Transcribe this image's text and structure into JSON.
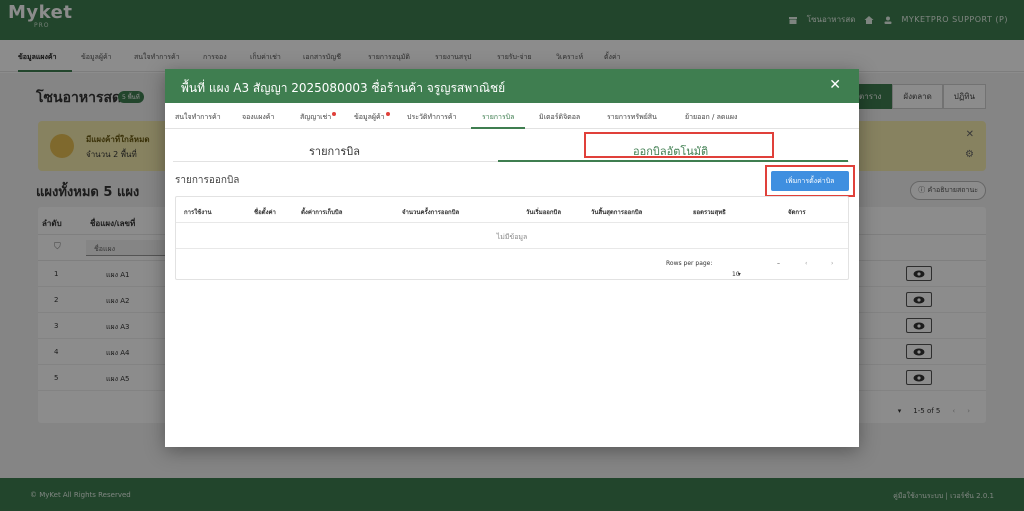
{
  "app": {
    "logo_main": "Myket",
    "logo_sub": "PRO",
    "top_zone": "โซนอาหารสด",
    "user": "MYKETPRO SUPPORT (P)"
  },
  "nav": {
    "tabs": [
      "ข้อมูลแผงค้า",
      "ข้อมูลผู้ค้า",
      "สนใจทำการค้า",
      "การจอง",
      "เก็บค่าเช่า",
      "เอกสารบัญชี",
      "รายการอนุมัติ",
      "รายงานสรุป",
      "รายรับ-จ่าย",
      "วิเคราะห์",
      "ตั้งค่า"
    ]
  },
  "page": {
    "zone_title": "โซนอาหารสด",
    "zone_badge": "5 พื้นที่",
    "view_buttons": [
      "ตาราง",
      "ผังตลาด",
      "ปฏิทิน"
    ],
    "banner_title": "มีแผงค้าที่ใกล้หมด",
    "banner_sub": "จำนวน 2 พื้นที่",
    "count_title": "แผงทั้งหมด 5 แผง",
    "legend_btn": "คำอธิบายสถานะ",
    "table_headers": [
      "ลำดับ",
      "ชื่อแผง/เลขที่"
    ],
    "filter_placeholder": "ชื่อแผง",
    "rows": [
      {
        "idx": "1",
        "name": "แผง A1"
      },
      {
        "idx": "2",
        "name": "แผง A2"
      },
      {
        "idx": "3",
        "name": "แผง A3"
      },
      {
        "idx": "4",
        "name": "แผง A4"
      },
      {
        "idx": "5",
        "name": "แผง A5"
      }
    ],
    "pagination": "1-5 of 5"
  },
  "footer": {
    "left": "© MyKet All Rights Reserved",
    "right": "คู่มือใช้งานระบบ | เวอร์ชั่น 2.0.1"
  },
  "modal": {
    "title": "พื้นที่ แผง A3  สัญญา 2025080003 ชื่อร้านค้า จรูญรสพาณิชย์",
    "tabs": [
      "สนใจทำการค้า",
      "จองแผงค้า",
      "สัญญาเช่า",
      "ข้อมูลผู้ค้า",
      "ประวัติทำการค้า",
      "รายการบิล",
      "มิเตอร์ดิจิตอล",
      "รายการทรัพย์สิน",
      "ย้ายออก / ลดแผง"
    ],
    "subtabs": [
      "รายการบิล",
      "ออกบิลอัตโนมัติ"
    ],
    "section_title": "รายการออกบิล",
    "add_button": "เพิ่มการตั้งค่าบิล",
    "table_headers": [
      "การใช้งาน",
      "ชื่อตั้งค่า",
      "ตั้งค่าการเก็บบิล",
      "จำนวนครั้งการออกบิล",
      "วันเริ่มออกบิล",
      "วันสิ้นสุดการออกบิล",
      "ยอดรวมสุทธิ",
      "จัดการ"
    ],
    "empty_text": "ไม่มีข้อมูล",
    "rows_per_page_label": "Rows per page:",
    "rows_per_page_value": "10",
    "range_text": "–"
  },
  "colors": {
    "brand_green": "#3f7e50",
    "accent_blue": "#3f8fe0",
    "highlight_red": "#e0403a"
  }
}
